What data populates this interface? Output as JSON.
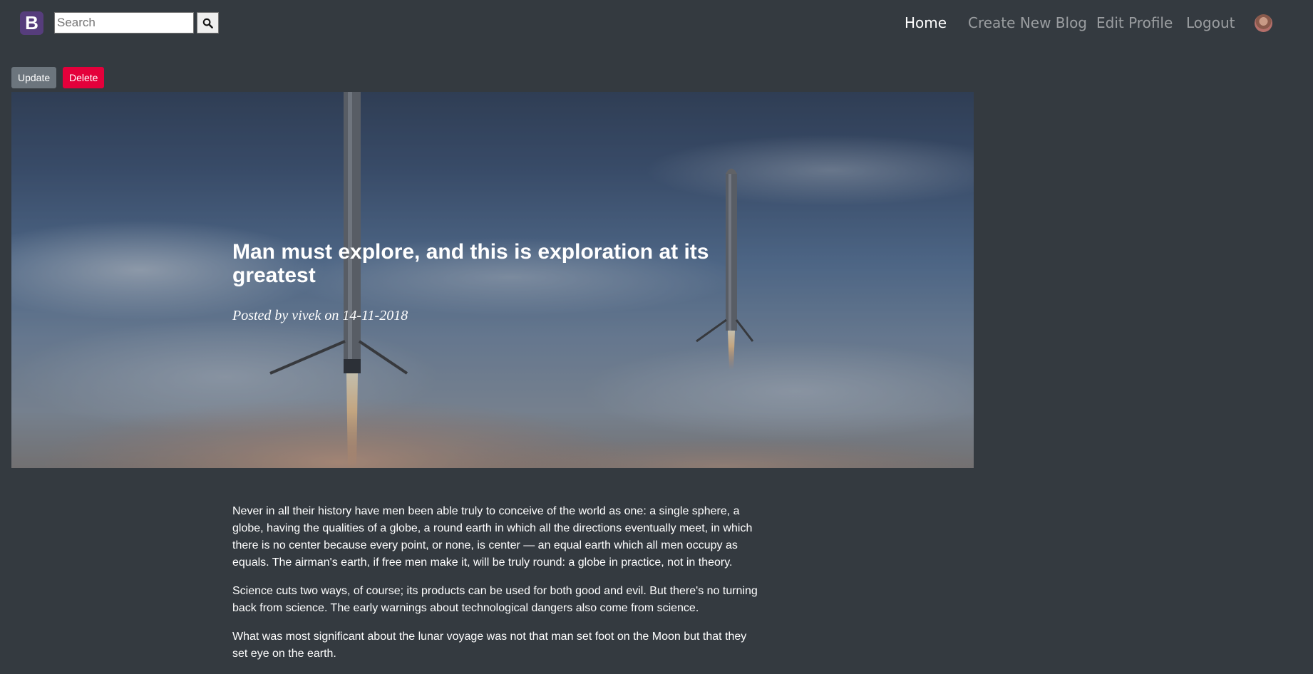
{
  "navbar": {
    "brand_letter": "B",
    "search_placeholder": "Search",
    "links": [
      {
        "label": "Home",
        "active": true
      },
      {
        "label": "Create New Blog",
        "active": false
      },
      {
        "label": "Edit Profile",
        "active": false
      },
      {
        "label": "Logout",
        "active": false
      }
    ]
  },
  "actions": {
    "update_label": "Update",
    "delete_label": "Delete"
  },
  "post": {
    "title": "Man must explore, and this is exploration at its greatest",
    "meta": "Posted by vivek on 14-11-2018",
    "paragraphs": [
      "Never in all their history have men been able truly to conceive of the world as one: a single sphere, a globe, having the qualities of a globe, a round earth in which all the directions eventually meet, in which there is no center because every point, or none, is center — an equal earth which all men occupy as equals. The airman's earth, if free men make it, will be truly round: a globe in practice, not in theory.",
      "Science cuts two ways, of course; its products can be used for both good and evil. But there's no turning back from science. The early warnings about technological dangers also come from science.",
      "What was most significant about the lunar voyage was not that man set foot on the Moon but that they set eye on the earth."
    ]
  },
  "colors": {
    "page_bg": "#343a40",
    "brand_bg": "#563d7c",
    "update_bg": "#6c757d",
    "delete_bg": "#e4003b"
  },
  "icons": {
    "search": "search-icon",
    "brand": "bootstrap-logo-icon",
    "avatar": "user-avatar"
  }
}
